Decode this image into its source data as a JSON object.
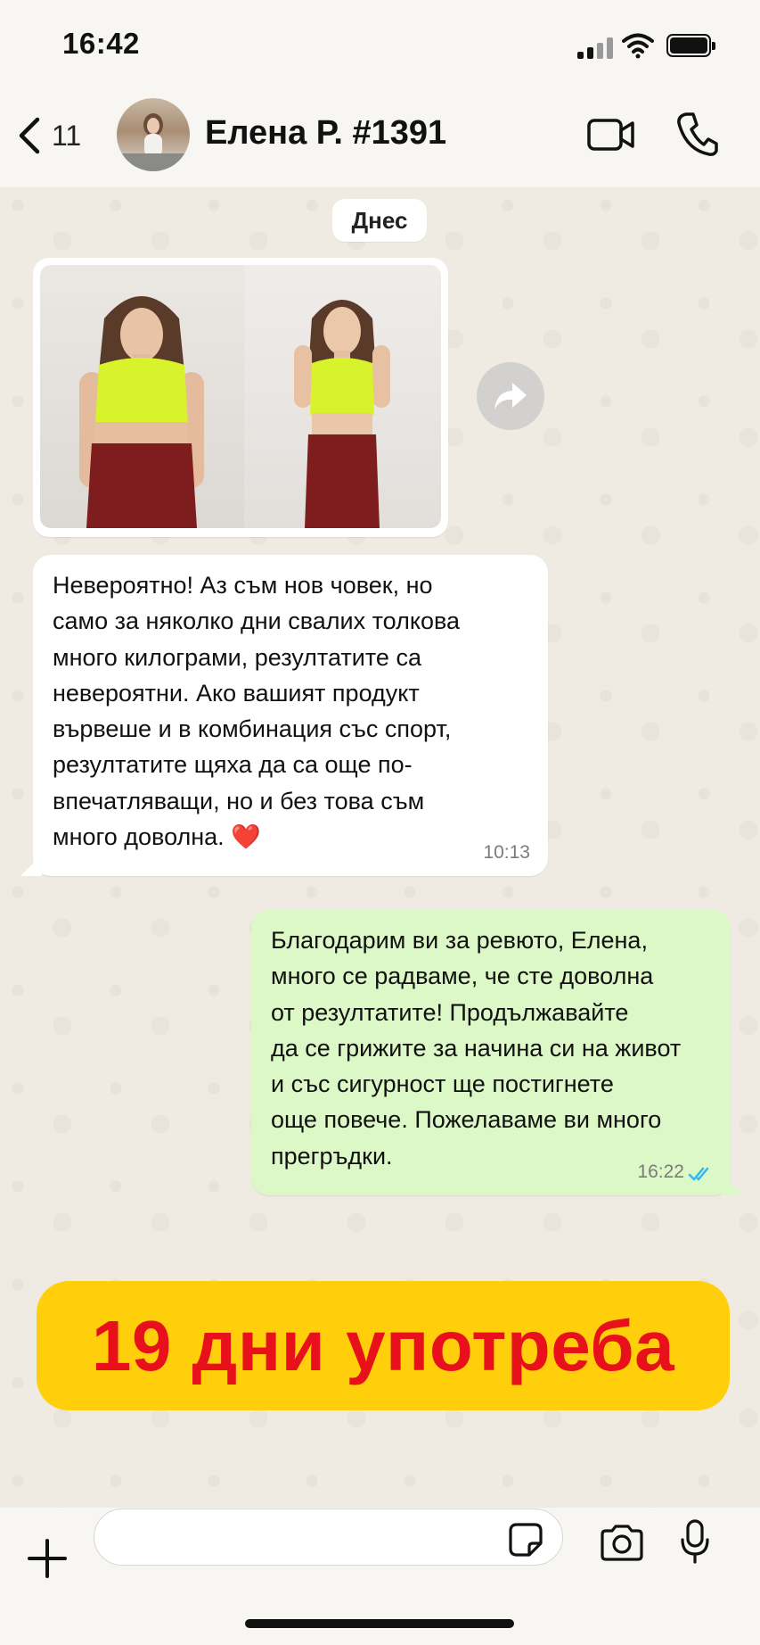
{
  "status_bar": {
    "time": "16:42"
  },
  "header": {
    "back_count": "11",
    "contact_name": "Елена Р. #1391"
  },
  "chat": {
    "date_chip": "Днес",
    "incoming": {
      "text": "Невероятно! Аз съм нов човек, но\nсамо за няколко дни свалих толкова\nмного килограми, резултатите са\nневероятни. Ако вашият продукт\nвървеше и в комбинация със спорт,\nрезултатите щяха да са още по-\nвпечатляващи, но и без това съм\nмного доволна. ❤️",
      "time": "10:13"
    },
    "outgoing": {
      "text": "Благодарим ви за ревюто, Елена,\nмного се радваме, че сте доволна\nот резултатите! Продължавайте\nда се грижите за начина си на живот\nи със сигурност ще постигнете\nоще повече. Пожелаваме ви много\nпрегръдки.",
      "time": "16:22"
    }
  },
  "banner": {
    "text": "19 дни употреба"
  },
  "input": {
    "value": "",
    "placeholder": ""
  },
  "colors": {
    "outgoing_bubble": "#dcf8c6",
    "banner_bg": "#fecf0a",
    "banner_text": "#e8111b",
    "read_ticks": "#34b7f1"
  },
  "icons": [
    "back-chevron-icon",
    "video-camera-icon",
    "phone-icon",
    "forward-icon",
    "plus-icon",
    "sticker-icon",
    "camera-icon",
    "microphone-icon",
    "double-check-icon"
  ]
}
